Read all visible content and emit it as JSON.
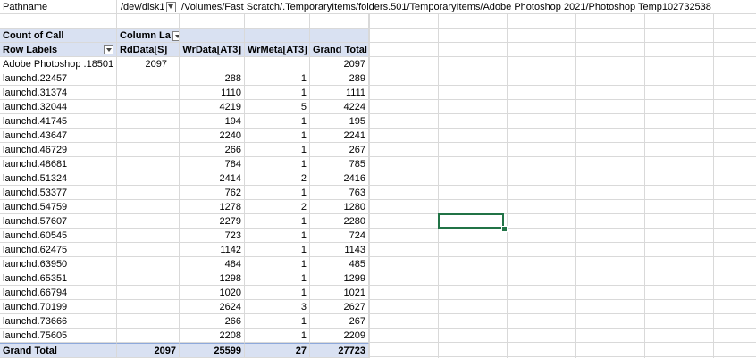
{
  "filter": {
    "label": "Pathname",
    "disk": "/dev/disk1",
    "icon": "filter-dropdown-icon",
    "path": "/Volumes/Fast Scratch/.TemporaryItems/folders.501/TemporaryItems/Adobe Photoshop 2021/Photoshop Temp102732538"
  },
  "pivot": {
    "count_label": "Count of Call",
    "column_labels": "Column La",
    "row_labels": "Row Labels",
    "columns": [
      "RdData[S]",
      "WrData[AT3]",
      "WrMeta[AT3]",
      "Grand Total"
    ],
    "rows": [
      {
        "label": "Adobe Photoshop .18501",
        "rd": "2097",
        "wrdata": "",
        "wrmeta": "",
        "total": "2097"
      },
      {
        "label": "launchd.22457",
        "rd": "",
        "wrdata": "288",
        "wrmeta": "1",
        "total": "289"
      },
      {
        "label": "launchd.31374",
        "rd": "",
        "wrdata": "1110",
        "wrmeta": "1",
        "total": "1111"
      },
      {
        "label": "launchd.32044",
        "rd": "",
        "wrdata": "4219",
        "wrmeta": "5",
        "total": "4224"
      },
      {
        "label": "launchd.41745",
        "rd": "",
        "wrdata": "194",
        "wrmeta": "1",
        "total": "195"
      },
      {
        "label": "launchd.43647",
        "rd": "",
        "wrdata": "2240",
        "wrmeta": "1",
        "total": "2241"
      },
      {
        "label": "launchd.46729",
        "rd": "",
        "wrdata": "266",
        "wrmeta": "1",
        "total": "267"
      },
      {
        "label": "launchd.48681",
        "rd": "",
        "wrdata": "784",
        "wrmeta": "1",
        "total": "785"
      },
      {
        "label": "launchd.51324",
        "rd": "",
        "wrdata": "2414",
        "wrmeta": "2",
        "total": "2416"
      },
      {
        "label": "launchd.53377",
        "rd": "",
        "wrdata": "762",
        "wrmeta": "1",
        "total": "763"
      },
      {
        "label": "launchd.54759",
        "rd": "",
        "wrdata": "1278",
        "wrmeta": "2",
        "total": "1280"
      },
      {
        "label": "launchd.57607",
        "rd": "",
        "wrdata": "2279",
        "wrmeta": "1",
        "total": "2280"
      },
      {
        "label": "launchd.60545",
        "rd": "",
        "wrdata": "723",
        "wrmeta": "1",
        "total": "724"
      },
      {
        "label": "launchd.62475",
        "rd": "",
        "wrdata": "1142",
        "wrmeta": "1",
        "total": "1143"
      },
      {
        "label": "launchd.63950",
        "rd": "",
        "wrdata": "484",
        "wrmeta": "1",
        "total": "485"
      },
      {
        "label": "launchd.65351",
        "rd": "",
        "wrdata": "1298",
        "wrmeta": "1",
        "total": "1299"
      },
      {
        "label": "launchd.66794",
        "rd": "",
        "wrdata": "1020",
        "wrmeta": "1",
        "total": "1021"
      },
      {
        "label": "launchd.70199",
        "rd": "",
        "wrdata": "2624",
        "wrmeta": "3",
        "total": "2627"
      },
      {
        "label": "launchd.73666",
        "rd": "",
        "wrdata": "266",
        "wrmeta": "1",
        "total": "267"
      },
      {
        "label": "launchd.75605",
        "rd": "",
        "wrdata": "2208",
        "wrmeta": "1",
        "total": "2209"
      }
    ],
    "grand_total": {
      "label": "Grand Total",
      "rd": "2097",
      "wrdata": "25599",
      "wrmeta": "27",
      "total": "27723"
    }
  },
  "colors": {
    "header_fill": "#d9e1f2",
    "selection": "#217346",
    "gridline": "#d9d9d9"
  }
}
